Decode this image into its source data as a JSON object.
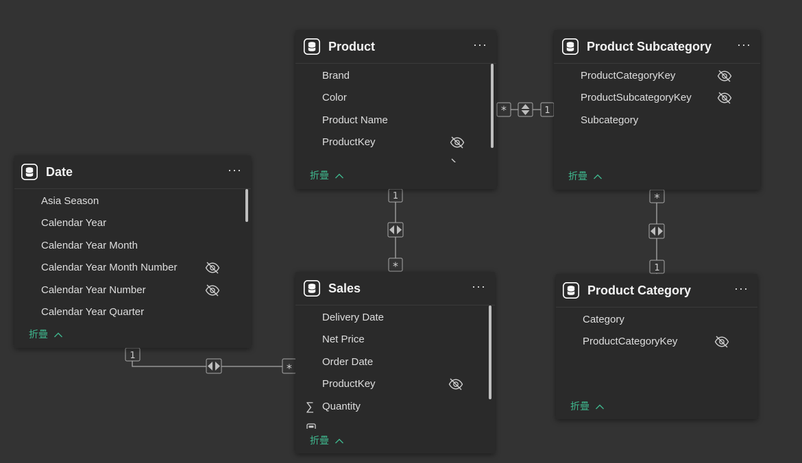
{
  "collapse_label": "折疊",
  "accent_color": "#3fb88e",
  "background_color": "#333333",
  "tables": {
    "product": {
      "title": "Product",
      "fields": [
        {
          "label": "Brand",
          "hidden": false
        },
        {
          "label": "Color",
          "hidden": false
        },
        {
          "label": "Product Name",
          "hidden": false
        },
        {
          "label": "ProductKey",
          "hidden": true
        }
      ]
    },
    "product_subcategory": {
      "title": "Product Subcategory",
      "fields": [
        {
          "label": "ProductCategoryKey",
          "hidden": true
        },
        {
          "label": "ProductSubcategoryKey",
          "hidden": true
        },
        {
          "label": "Subcategory",
          "hidden": false
        }
      ]
    },
    "date": {
      "title": "Date",
      "fields": [
        {
          "label": "Asia Season",
          "hidden": false
        },
        {
          "label": "Calendar Year",
          "hidden": false
        },
        {
          "label": "Calendar Year Month",
          "hidden": false
        },
        {
          "label": "Calendar Year Month Number",
          "hidden": true
        },
        {
          "label": "Calendar Year Number",
          "hidden": true
        },
        {
          "label": "Calendar Year Quarter",
          "hidden": false
        }
      ]
    },
    "sales": {
      "title": "Sales",
      "fields": [
        {
          "label": "Delivery Date",
          "hidden": false
        },
        {
          "label": "Net Price",
          "hidden": false
        },
        {
          "label": "Order Date",
          "hidden": false
        },
        {
          "label": "ProductKey",
          "hidden": true
        },
        {
          "label": "Quantity",
          "hidden": false,
          "measure": true
        }
      ]
    },
    "product_category": {
      "title": "Product Category",
      "fields": [
        {
          "label": "Category",
          "hidden": false
        },
        {
          "label": "ProductCategoryKey",
          "hidden": true
        }
      ]
    }
  },
  "relationships": [
    {
      "from": "Product",
      "to": "Product Subcategory",
      "from_card": "*",
      "to_card": "1",
      "direction": "both"
    },
    {
      "from": "Product",
      "to": "Sales",
      "from_card": "1",
      "to_card": "*",
      "direction": "both"
    },
    {
      "from": "Product Subcategory",
      "to": "Product Category",
      "from_card": "*",
      "to_card": "1",
      "direction": "both"
    },
    {
      "from": "Date",
      "to": "Sales",
      "from_card": "1",
      "to_card": "*",
      "direction": "both"
    }
  ]
}
